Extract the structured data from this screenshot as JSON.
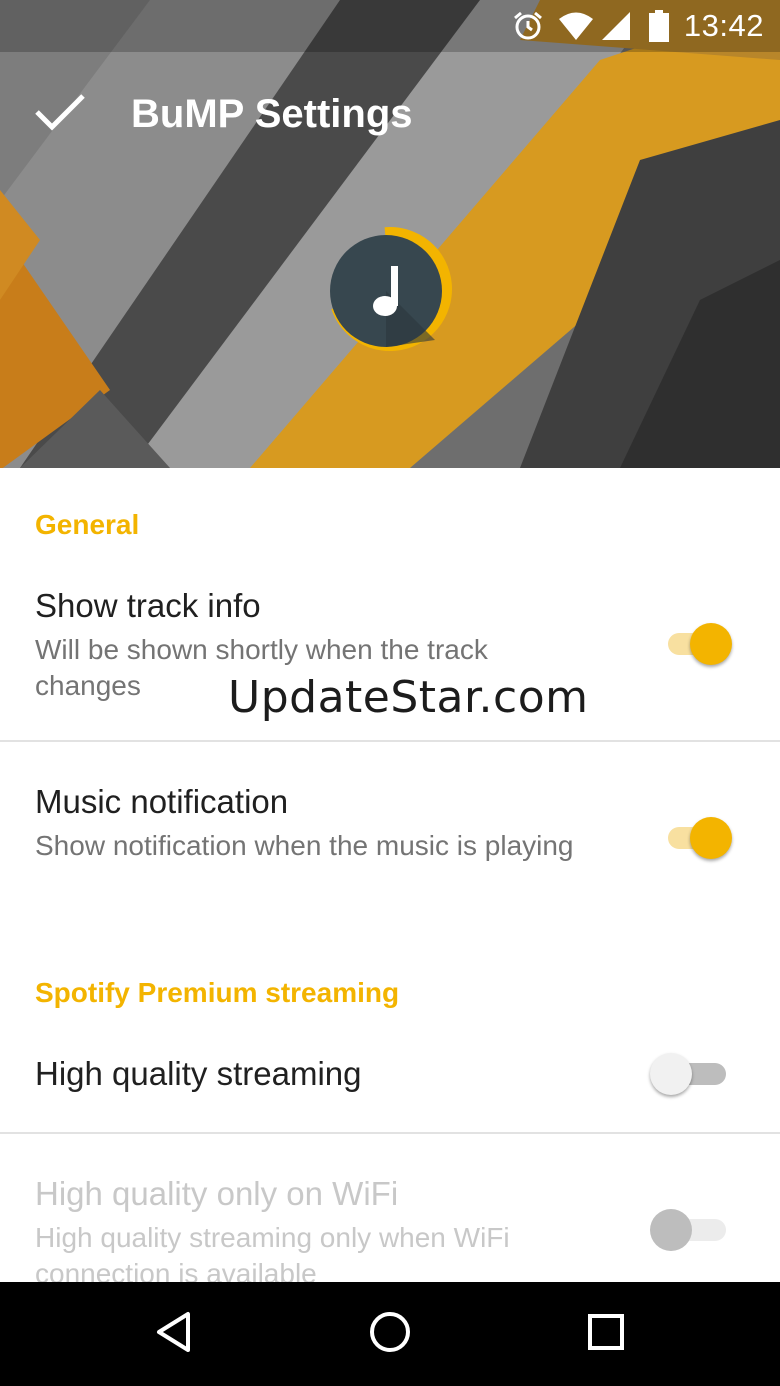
{
  "status_bar": {
    "time": "13:42",
    "icons": [
      "alarm-icon",
      "wifi-icon",
      "signal-icon",
      "battery-icon"
    ]
  },
  "toolbar": {
    "title": "BuMP Settings",
    "confirm_icon": "check-icon"
  },
  "header": {
    "logo_icon": "music-note-icon",
    "accent_color": "#f3b400"
  },
  "sections": [
    {
      "title": "General",
      "items": [
        {
          "title": "Show track info",
          "summary": "Will be shown shortly when the track changes",
          "enabled": true,
          "checked": true
        },
        {
          "title": "Music notification",
          "summary": "Show notification when the music is playing",
          "enabled": true,
          "checked": true
        }
      ]
    },
    {
      "title": "Spotify Premium streaming",
      "items": [
        {
          "title": "High quality streaming",
          "summary": "",
          "enabled": true,
          "checked": false
        },
        {
          "title": "High quality only on WiFi",
          "summary": "High quality streaming only when WiFi connection is available",
          "enabled": false,
          "checked": false
        }
      ]
    }
  ],
  "watermark": "UpdateStar.com",
  "nav_bar": {
    "buttons": [
      "back-icon",
      "home-icon",
      "recents-icon"
    ]
  }
}
